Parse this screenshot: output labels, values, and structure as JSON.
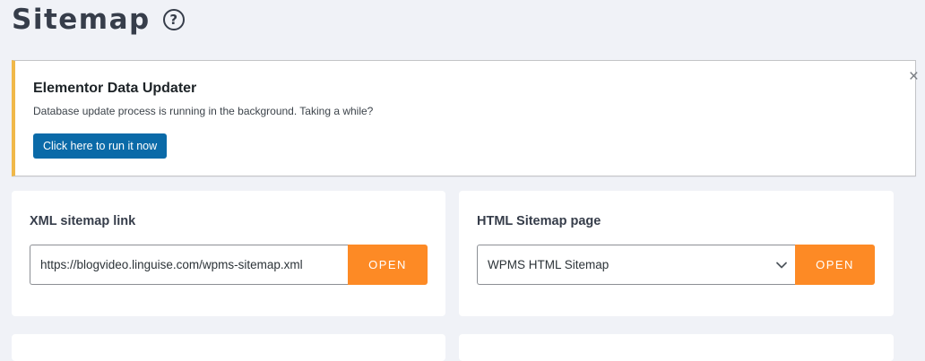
{
  "page": {
    "title": "Sitemap",
    "help_icon_glyph": "?"
  },
  "notice": {
    "title": "Elementor Data Updater",
    "message": "Database update process is running in the background. Taking a while?",
    "button_label": "Click here to run it now",
    "close_glyph": "×",
    "accent_color": "#f0b849"
  },
  "xml_sitemap": {
    "label": "XML sitemap link",
    "url": "https://blogvideo.linguise.com/wpms-sitemap.xml",
    "open_label": "OPEN"
  },
  "html_sitemap": {
    "label": "HTML Sitemap page",
    "selected_page": "WPMS HTML Sitemap",
    "open_label": "OPEN"
  },
  "colors": {
    "open_button": "#fd8a25",
    "primary_button": "#0a6aa8",
    "background": "#f0f2f7"
  }
}
